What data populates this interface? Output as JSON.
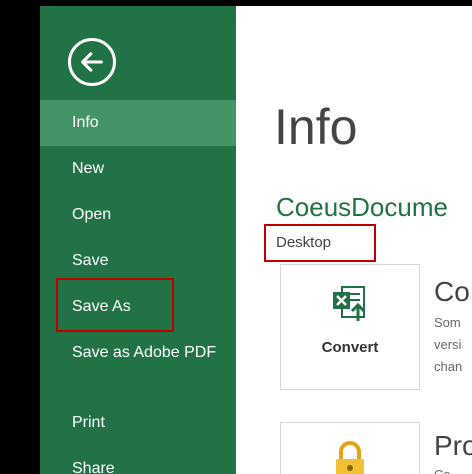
{
  "sidebar": {
    "items": [
      {
        "label": "Info"
      },
      {
        "label": "New"
      },
      {
        "label": "Open"
      },
      {
        "label": "Save"
      },
      {
        "label": "Save As"
      },
      {
        "label": "Save as Adobe PDF"
      },
      {
        "label": "Print"
      },
      {
        "label": "Share"
      }
    ]
  },
  "main": {
    "title": "Info",
    "document_name": "CoeusDocume",
    "document_location": "Desktop",
    "convert": {
      "button_label": "Convert",
      "heading": "Co",
      "desc_lines": [
        "Som",
        "versi",
        "chan"
      ]
    },
    "protect": {
      "heading": "Pro",
      "desc_line": "Co"
    }
  },
  "colors": {
    "sidebar_bg": "#217346",
    "sidebar_active": "#439467",
    "highlight_box": "#c00000",
    "accent_text": "#217346"
  },
  "icons": {
    "back": "back-arrow-icon",
    "convert": "excel-convert-icon",
    "protect": "lock-icon"
  }
}
